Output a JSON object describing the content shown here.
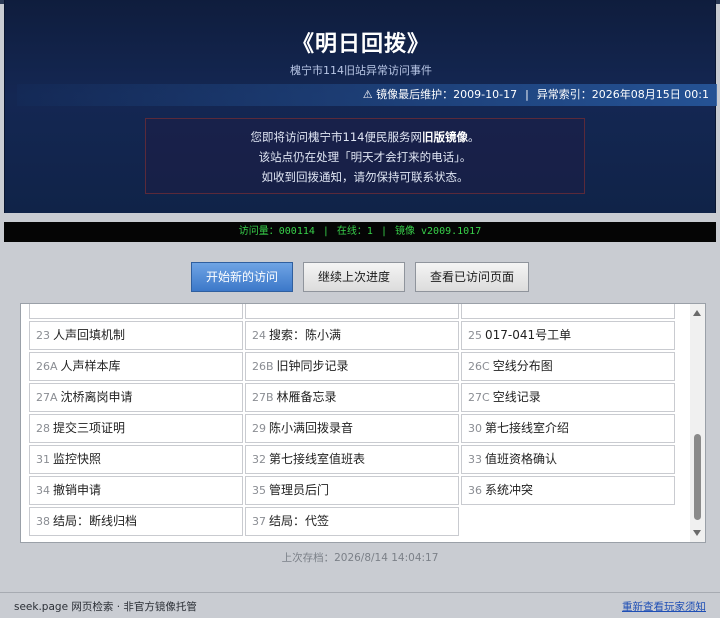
{
  "header": {
    "title": "《明日回拨》",
    "subtitle": "槐宁市114旧站异常访问事件",
    "maintenance_label": "⚠ 镜像最后维护：2009-10-17",
    "separator": "|",
    "index_label": "异常索引：2026年08月15日 00:1"
  },
  "notice": {
    "line1_prefix": "您即将访问槐宁市114便民服务网",
    "line1_bold": "旧版镜像",
    "line1_suffix": "。",
    "line2": "该站点仍在处理「明天才会打来的电话」。",
    "line3": "如收到回拨通知，请勿保持可联系状态。"
  },
  "counter": {
    "visits": "访问量：000114",
    "online": "在线：1",
    "mirror": "镜像 v2009.1017",
    "separator": "|"
  },
  "buttons": {
    "new_visit": "开始新的访问",
    "continue": "继续上次进度",
    "visited": "查看已访问页面"
  },
  "records": [
    [
      {
        "num": "23",
        "label": "人声回填机制"
      },
      {
        "num": "24",
        "label": "搜索：陈小满"
      },
      {
        "num": "25",
        "label": "017-041号工单"
      }
    ],
    [
      {
        "num": "26A",
        "label": "人声样本库"
      },
      {
        "num": "26B",
        "label": "旧钟同步记录"
      },
      {
        "num": "26C",
        "label": "空线分布图"
      }
    ],
    [
      {
        "num": "27A",
        "label": "沈桥离岗申请"
      },
      {
        "num": "27B",
        "label": "林雁备忘录"
      },
      {
        "num": "27C",
        "label": "空线记录"
      }
    ],
    [
      {
        "num": "28",
        "label": "提交三项证明"
      },
      {
        "num": "29",
        "label": "陈小满回拨录音"
      },
      {
        "num": "30",
        "label": "第七接线室介绍"
      }
    ],
    [
      {
        "num": "31",
        "label": "监控快照"
      },
      {
        "num": "32",
        "label": "第七接线室值班表"
      },
      {
        "num": "33",
        "label": "值班资格确认"
      }
    ],
    [
      {
        "num": "34",
        "label": "撤销申请"
      },
      {
        "num": "35",
        "label": "管理员后门"
      },
      {
        "num": "36",
        "label": "系统冲突"
      }
    ],
    [
      {
        "num": "38",
        "label": "结局：断线归档"
      },
      {
        "num": "37",
        "label": "结局：代签"
      }
    ]
  ],
  "saved": "上次存档：2026/8/14 14:04:17",
  "footer": {
    "left": "seek.page 网页检索 · 非官方镜像托管",
    "right": "重新查看玩家须知"
  },
  "colors": {
    "header_bg": "#142753",
    "counter_text": "#38d14a",
    "primary_button": "#4a86d6"
  }
}
